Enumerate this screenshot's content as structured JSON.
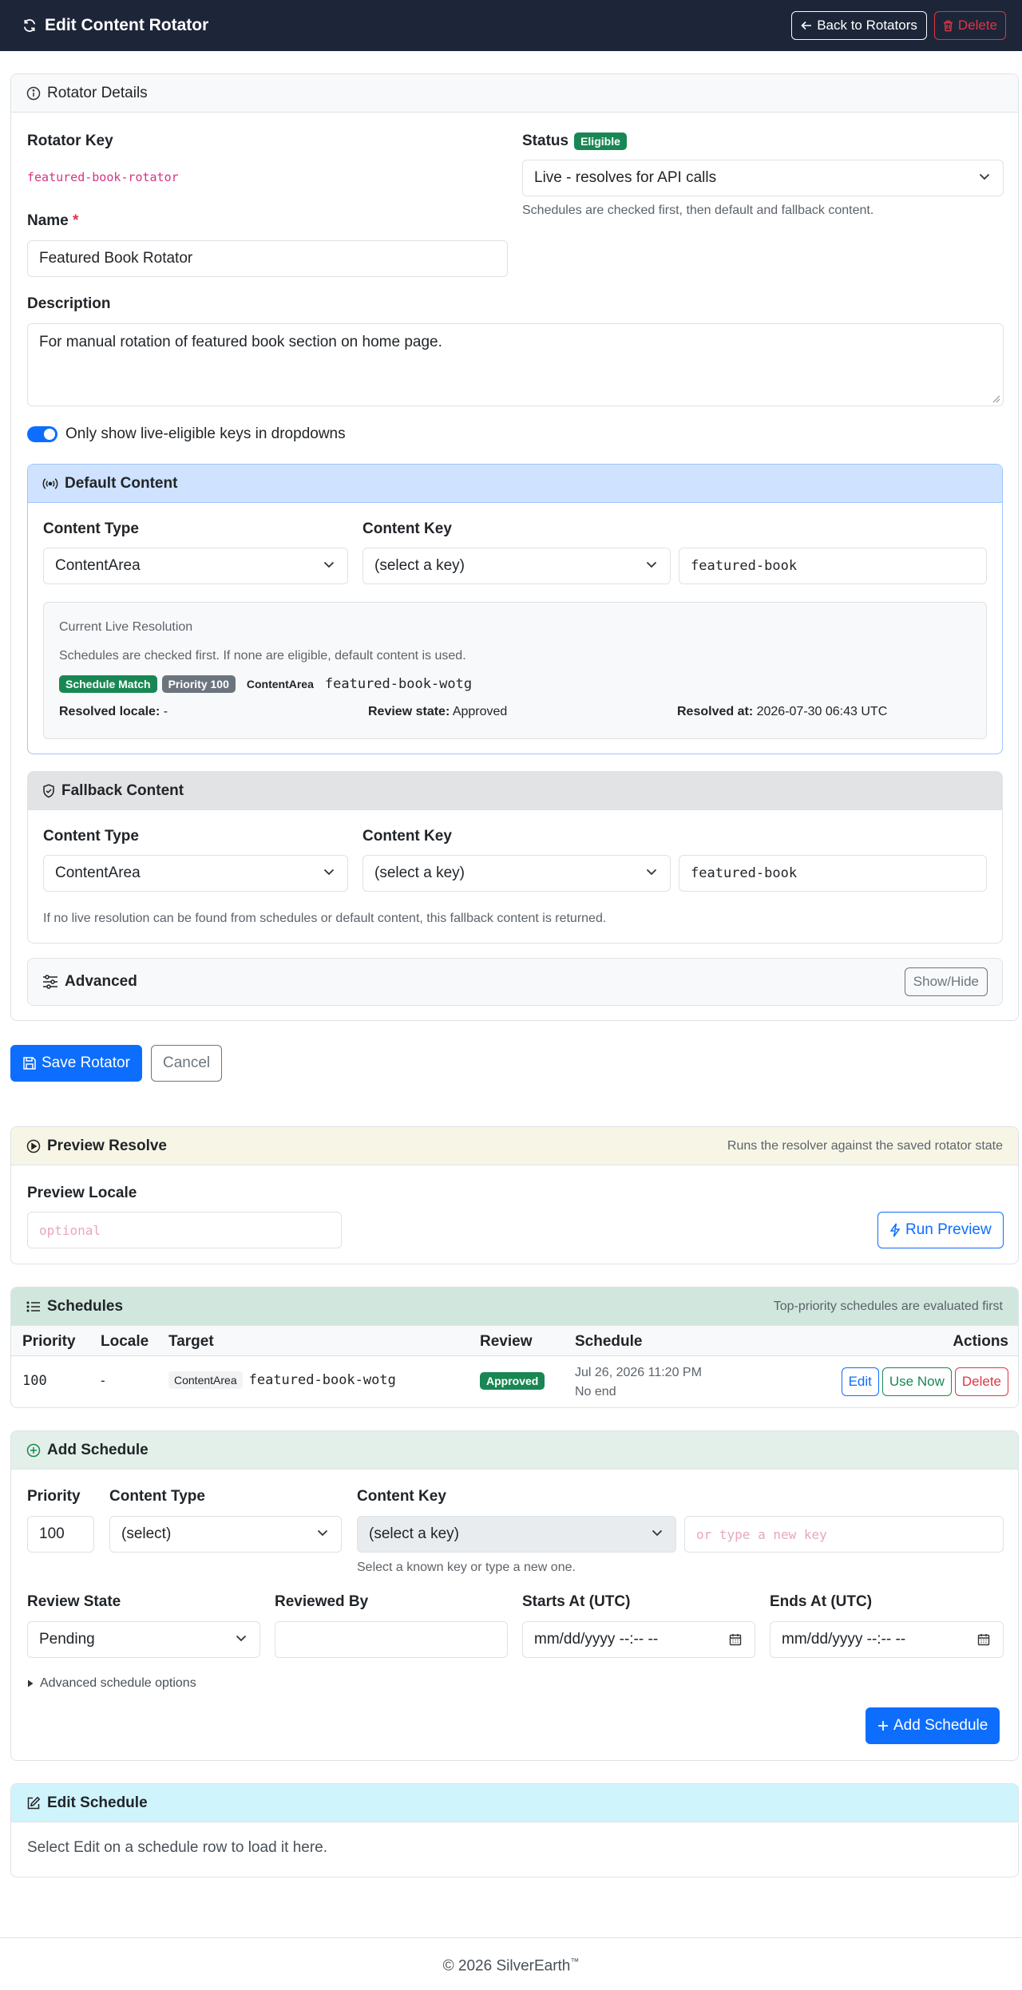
{
  "header": {
    "title": "Edit Content Rotator",
    "back_label": "Back to Rotators",
    "delete_label": "Delete"
  },
  "details": {
    "header": "Rotator Details",
    "key_label": "Rotator Key",
    "key_value": "featured-book-rotator",
    "status_label": "Status",
    "status_badge": "Eligible",
    "status_value": "Live - resolves for API calls",
    "status_help": "Schedules are checked first, then default and fallback content.",
    "name_label": "Name",
    "required_mark": "*",
    "name_value": "Featured Book Rotator",
    "description_label": "Description",
    "description_value": "For manual rotation of featured book section on home page.",
    "toggle_label": "Only show live-eligible keys in dropdowns",
    "toggle_on": true
  },
  "default_content": {
    "header": "Default Content",
    "content_type_label": "Content Type",
    "content_type_value": "ContentArea",
    "content_key_label": "Content Key",
    "content_key_select": "(select a key)",
    "content_key_value": "featured-book",
    "resolution": {
      "title": "Current Live Resolution",
      "description": "Schedules are checked first. If none are eligible, default content is used.",
      "badge_match": "Schedule Match",
      "badge_priority": "Priority 100",
      "type": "ContentArea",
      "key": "featured-book-wotg",
      "locale_label": "Resolved locale:",
      "locale_value": "-",
      "review_label": "Review state:",
      "review_value": "Approved",
      "resolved_label": "Resolved at:",
      "resolved_value": "2026-07-30 06:43 UTC"
    }
  },
  "fallback_content": {
    "header": "Fallback Content",
    "content_type_label": "Content Type",
    "content_type_value": "ContentArea",
    "content_key_label": "Content Key",
    "content_key_select": "(select a key)",
    "content_key_value": "featured-book",
    "help": "If no live resolution can be found from schedules or default content, this fallback content is returned."
  },
  "advanced": {
    "header": "Advanced",
    "toggle_label": "Show/Hide"
  },
  "form_actions": {
    "save_label": "Save Rotator",
    "cancel_label": "Cancel"
  },
  "preview": {
    "header": "Preview Resolve",
    "note": "Runs the resolver against the saved rotator state",
    "locale_label": "Preview Locale",
    "locale_placeholder": "optional",
    "run_label": "Run Preview"
  },
  "schedules": {
    "header": "Schedules",
    "note": "Top-priority schedules are evaluated first",
    "columns": [
      "Priority",
      "Locale",
      "Target",
      "Review",
      "Schedule",
      "Actions"
    ],
    "rows": [
      {
        "priority": "100",
        "locale": "-",
        "target_type": "ContentArea",
        "target_key": "featured-book-wotg",
        "review": "Approved",
        "schedule_start": "Jul 26, 2026 11:20 PM",
        "schedule_end": "No end",
        "edit_label": "Edit",
        "use_now_label": "Use Now",
        "delete_label": "Delete"
      }
    ]
  },
  "add_schedule": {
    "header": "Add Schedule",
    "priority_label": "Priority",
    "priority_value": "100",
    "content_type_label": "Content Type",
    "content_type_value": "(select)",
    "content_key_label": "Content Key",
    "content_key_select": "(select a key)",
    "content_key_placeholder": "or type a new key",
    "content_key_help": "Select a known key or type a new one.",
    "review_state_label": "Review State",
    "review_state_value": "Pending",
    "reviewed_by_label": "Reviewed By",
    "reviewed_by_value": "",
    "starts_label": "Starts At (UTC)",
    "starts_placeholder": "mm/dd/yyyy --:-- --",
    "ends_label": "Ends At (UTC)",
    "ends_placeholder": "mm/dd/yyyy --:-- --",
    "advanced_options": "Advanced schedule options",
    "submit_label": "Add Schedule"
  },
  "edit_schedule": {
    "header": "Edit Schedule",
    "empty_message": "Select Edit on a schedule row to load it here."
  },
  "footer": {
    "copyright": "© 2026 SilverEarth",
    "tm": "™"
  },
  "colors": {
    "topbar": "#1d2638",
    "primary": "#0d6efd",
    "success": "#198754",
    "danger": "#dc3545",
    "secondary": "#6c757d",
    "code_pink": "#d63384"
  }
}
